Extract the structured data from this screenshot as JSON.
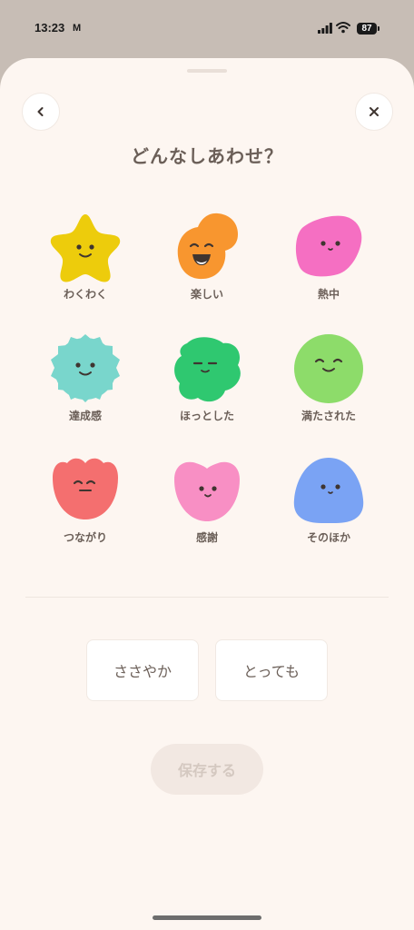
{
  "status_bar": {
    "time": "13:23",
    "mail_icon": "gmail-icon",
    "battery": "87"
  },
  "header": {
    "back_icon": "chevron-left-icon",
    "close_icon": "close-icon",
    "title": "どんなしあわせ？"
  },
  "moods": [
    {
      "label": "わくわく",
      "color": "#edcc0c",
      "shape": "star"
    },
    {
      "label": "楽しい",
      "color": "#f8962f",
      "shape": "blob-double"
    },
    {
      "label": "熱中",
      "color": "#f56fc2",
      "shape": "rounded-diamond"
    },
    {
      "label": "達成感",
      "color": "#79d6cc",
      "shape": "scalloped"
    },
    {
      "label": "ほっとした",
      "color": "#2fc870",
      "shape": "wavy"
    },
    {
      "label": "満たされた",
      "color": "#8ddc6a",
      "shape": "circle"
    },
    {
      "label": "つながり",
      "color": "#f46f6f",
      "shape": "tulip"
    },
    {
      "label": "感謝",
      "color": "#f88fc4",
      "shape": "heart-round"
    },
    {
      "label": "そのほか",
      "color": "#7aa3f4",
      "shape": "dome"
    }
  ],
  "intensity": {
    "small_label": "ささやか",
    "big_label": "とっても"
  },
  "save_label": "保存する"
}
